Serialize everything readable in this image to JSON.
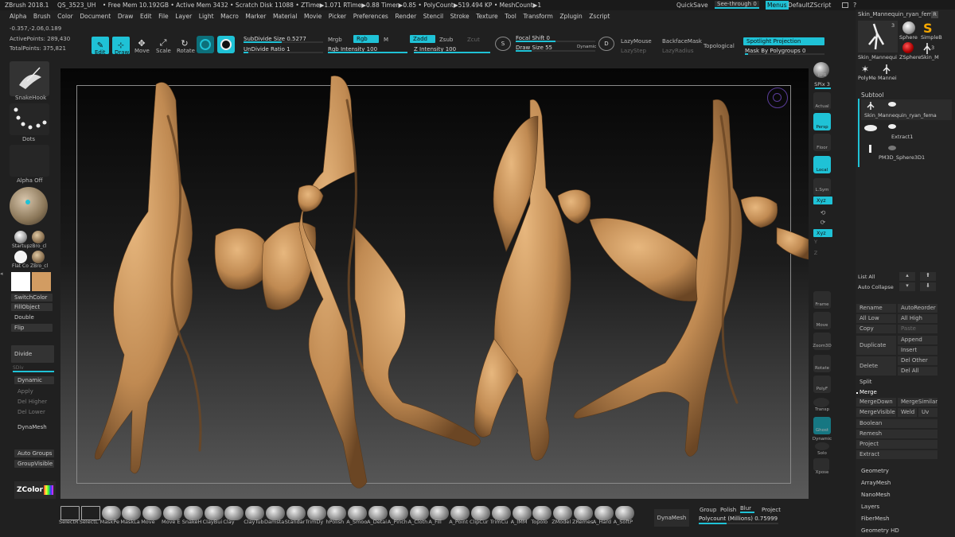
{
  "menubar": {
    "app_title": "ZBrush 2018.1",
    "document": "QS_3523_UH",
    "stats": "• Free Mem 10.192GB • Active Mem 3432 • Scratch Disk 11088 • ZTime▶1.071 RTime▶0.88 Timer▶0.85 • PolyCount▶519.494 KP • MeshCount▶1",
    "quicksave": "QuickSave",
    "see_through": "See-through",
    "see_through_value": "0",
    "menus": "Menus",
    "default_zscript": "DefaultZScript"
  },
  "menu_items": [
    "Alpha",
    "Brush",
    "Color",
    "Document",
    "Draw",
    "Edit",
    "File",
    "Layer",
    "Light",
    "Macro",
    "Marker",
    "Material",
    "Movie",
    "Picker",
    "Preferences",
    "Render",
    "Stencil",
    "Stroke",
    "Texture",
    "Tool",
    "Transform",
    "Zplugin",
    "Zscript"
  ],
  "info": {
    "coords": "-0.357,-2.06,0.189",
    "active_points": "ActivePoints: 289,430",
    "total_points": "TotalPoints: 375,821"
  },
  "toolbar": {
    "edit": "Edit",
    "draw": "Draw",
    "move": "Move",
    "scale": "Scale",
    "rotate": "Rotate",
    "subdivide_size": "SubDivide Size 0.5277",
    "undivide_ratio": "UnDivide Ratio 1",
    "mrgb": "Mrgb",
    "rgb": "Rgb",
    "m": "M",
    "rgb_intensity": "Rgb Intensity 100",
    "zadd": "Zadd",
    "zsub": "Zsub",
    "zcut": "Zcut",
    "z_intensity": "Z Intensity 100",
    "focal_shift": "Focal Shift 0",
    "draw_size": "Draw Size 55",
    "dynamic": "Dynamic",
    "lazymouse": "LazyMouse",
    "lazystep": "LazyStep",
    "backfacemask": "BackfaceMask",
    "lazyradius": "LazyRadius",
    "topological": "Topological",
    "spotlight_projection": "Spotlight Projection",
    "mask_by_polygroups": "Mask By Polygroups 0"
  },
  "left_panel": {
    "snakehook": "SnakeHook",
    "dots": "Dots",
    "alpha_off": "Alpha Off",
    "startupzbro": "StartupzBro_cl",
    "flat_color": "Flat Co",
    "zbro_cl": "ZBro_cl",
    "switchcolor": "SwitchColor",
    "fillobject": "FillObject",
    "double": "Double",
    "flip": "Flip",
    "divide": "Divide",
    "sdiv": "SDiv",
    "dynamic": "Dynamic",
    "apply": "Apply",
    "del_higher": "Del Higher",
    "del_lower": "Del Lower",
    "dynamesh": "DynaMesh",
    "auto_groups": "Auto Groups",
    "group_visible": "GroupVisible",
    "zcolor": "ZColor"
  },
  "right_shelf": {
    "bpr": "BPR",
    "spix": "SPix 3",
    "actual": "Actual",
    "persp": "Persp",
    "floor": "Floor",
    "local": "Local",
    "lsym": "L.Sym",
    "xyz": "Xyz",
    "frame": "Frame",
    "move": "Move",
    "zoom3d": "Zoom3D",
    "rotate": "Rotate",
    "polyf": "PolyF",
    "transp": "Transp",
    "ghost": "Ghost",
    "dynamic": "Dynamic",
    "solo": "Solo",
    "xpose": "Xpose",
    "xyz_axis": "Xyz",
    "y": "Y",
    "z": "Z"
  },
  "tool_panel": {
    "current_tool": "Skin_Mannequin_ryan_fem",
    "r": "R",
    "count_3": "3",
    "sphere": "Sphere",
    "simple": "SimpleB",
    "skin_m": "Skin_Mannequi",
    "zsphere": "ZSphere",
    "skin_m2": "Skin_M",
    "polyme": "PolyMe Mannei",
    "subtool_title": "Subtool",
    "subtools": [
      "Skin_Mannequin_ryan_fema",
      "Extract1",
      "PM3D_Sphere3D1"
    ],
    "list_all": "List All",
    "auto_collapse": "Auto Collapse",
    "rename": "Rename",
    "autoreorder": "AutoReorder",
    "all_low": "All Low",
    "all_high": "All High",
    "copy": "Copy",
    "paste": "Paste",
    "duplicate": "Duplicate",
    "append": "Append",
    "insert": "Insert",
    "delete": "Delete",
    "del_other": "Del Other",
    "del_all": "Del All",
    "split": "Split",
    "merge": "Merge",
    "mergedown": "MergeDown",
    "mergesimilar": "MergeSimilar",
    "mergevisible": "MergeVisible",
    "weld": "Weld",
    "uv": "Uv",
    "boolean": "Boolean",
    "remesh": "Remesh",
    "project": "Project",
    "extract": "Extract",
    "sections": [
      "Geometry",
      "ArrayMesh",
      "NanoMesh",
      "Layers",
      "FiberMesh",
      "Geometry HD"
    ]
  },
  "bottom": {
    "brushes": [
      "SelectR",
      "SelectL",
      "MaskPe",
      "MaskLa",
      "Move",
      "Move E",
      "SnakeH",
      "ClayBui",
      "Clay",
      "ClayTub",
      "Damsta",
      "Standar",
      "TrimDy",
      "hPolish",
      "A_Smoo",
      "A_Detai",
      "A_Pinch",
      "A_Cloth",
      "A_Fill",
      "A_Point",
      "ClipCur",
      "TrimCu",
      "A_IMM",
      "Topolo",
      "ZModel",
      "ZRemes",
      "A_Hard",
      "A_SoftP"
    ],
    "dynamesh": "DynaMesh",
    "group": "Group",
    "polish": "Polish",
    "blur": "Blur",
    "project": "Project",
    "polycount": "Polycount (Millions) 0.75999"
  },
  "colors": {
    "accent": "#1fc2d6",
    "skin": "#c9935a",
    "bg": "#202020"
  }
}
